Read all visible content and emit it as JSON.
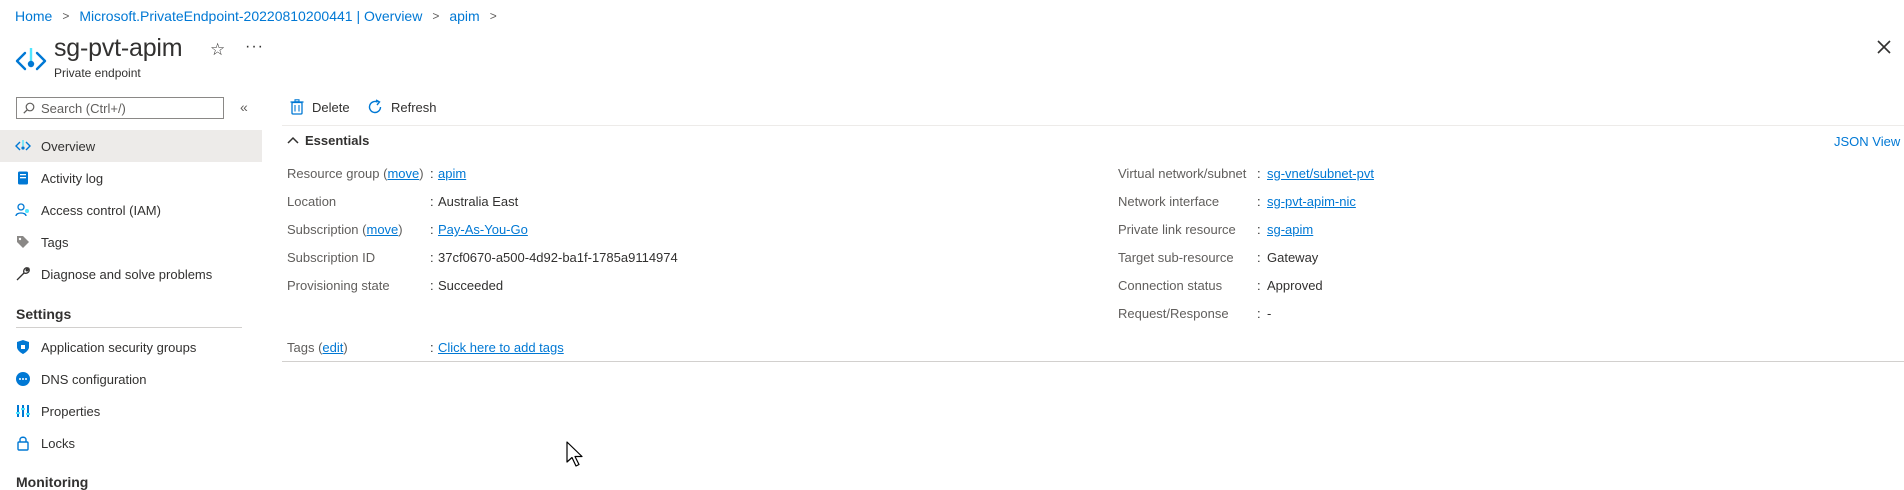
{
  "breadcrumb": [
    "Home",
    "Microsoft.PrivateEndpoint-20220810200441 | Overview",
    "apim"
  ],
  "header": {
    "title": "sg-pvt-apim",
    "subtitle": "Private endpoint"
  },
  "search": {
    "placeholder": "Search (Ctrl+/)"
  },
  "sidebar": {
    "items": [
      {
        "label": "Overview",
        "icon": "overview-icon"
      },
      {
        "label": "Activity log",
        "icon": "activity-log-icon"
      },
      {
        "label": "Access control (IAM)",
        "icon": "access-control-icon"
      },
      {
        "label": "Tags",
        "icon": "tag-icon"
      },
      {
        "label": "Diagnose and solve problems",
        "icon": "wrench-icon"
      }
    ],
    "settings_heading": "Settings",
    "settings_items": [
      {
        "label": "Application security groups",
        "icon": "shield-icon"
      },
      {
        "label": "DNS configuration",
        "icon": "dns-icon"
      },
      {
        "label": "Properties",
        "icon": "properties-icon"
      },
      {
        "label": "Locks",
        "icon": "lock-icon"
      }
    ],
    "monitoring_heading": "Monitoring"
  },
  "toolbar": {
    "delete": "Delete",
    "refresh": "Refresh"
  },
  "essentials": {
    "heading": "Essentials",
    "json_view": "JSON View",
    "move": "move",
    "left": [
      {
        "label": "Resource group",
        "value": "apim"
      },
      {
        "label": "Location",
        "value": "Australia East"
      },
      {
        "label": "Subscription",
        "value": "Pay-As-You-Go"
      },
      {
        "label": "Subscription ID",
        "value": "37cf0670-a500-4d92-ba1f-1785a9114974"
      },
      {
        "label": "Provisioning state",
        "value": "Succeeded"
      }
    ],
    "right": [
      {
        "label": "Virtual network/subnet",
        "value": "sg-vnet/subnet-pvt"
      },
      {
        "label": "Network interface",
        "value": "sg-pvt-apim-nic"
      },
      {
        "label": "Private link resource",
        "value": "sg-apim"
      },
      {
        "label": "Target sub-resource",
        "value": "Gateway"
      },
      {
        "label": "Connection status",
        "value": "Approved"
      },
      {
        "label": "Request/Response",
        "value": "-"
      }
    ],
    "tags_label": "Tags",
    "tags_edit": "edit",
    "tags_value": "Click here to add tags"
  },
  "colors": {
    "accent": "#0078d4",
    "text": "#323130",
    "muted": "#605e5c",
    "active_bg": "#edebe9"
  }
}
